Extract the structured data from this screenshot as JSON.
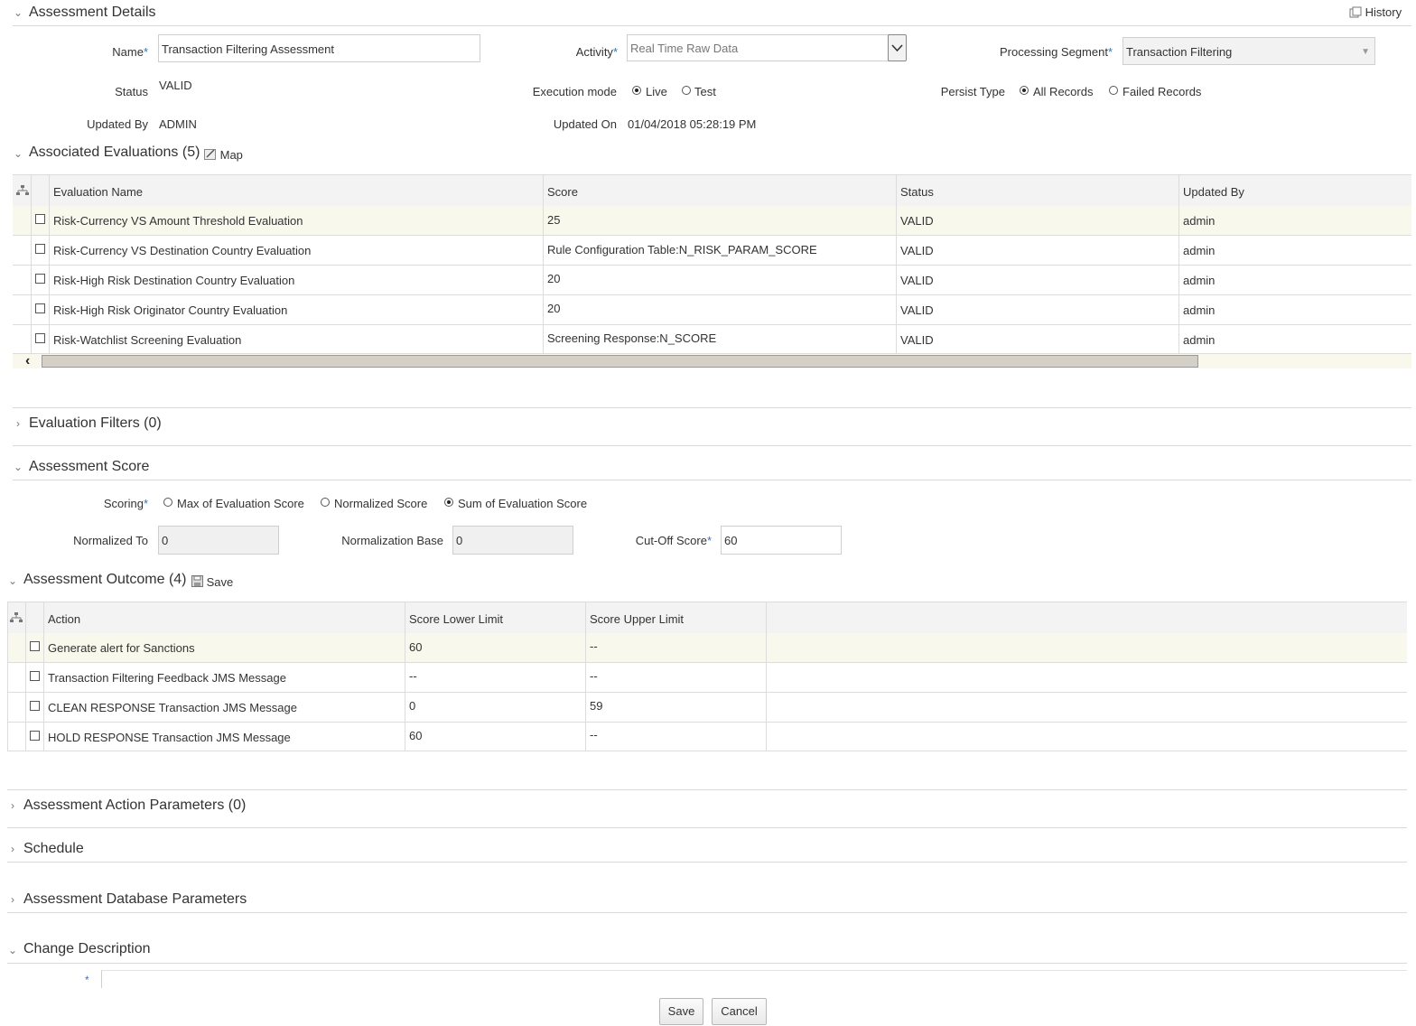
{
  "details": {
    "title": "Assessment Details",
    "history_label": "History",
    "name_label": "Name",
    "name_value": "Transaction Filtering Assessment",
    "activity_label": "Activity",
    "activity_value": "Real Time Raw Data",
    "processing_segment_label": "Processing Segment",
    "processing_segment_value": "Transaction Filtering",
    "status_label": "Status",
    "status_value": "VALID",
    "execution_mode_label": "Execution mode",
    "execution_options": [
      "Live",
      "Test"
    ],
    "execution_selected": "Live",
    "persist_type_label": "Persist Type",
    "persist_options": [
      "All Records",
      "Failed Records"
    ],
    "persist_selected": "All Records",
    "updated_by_label": "Updated By",
    "updated_by_value": "ADMIN",
    "updated_on_label": "Updated On",
    "updated_on_value": "01/04/2018 05:28:19 PM",
    "required_mark": "*"
  },
  "evaluations": {
    "title": "Associated Evaluations",
    "count": "(5)",
    "map_label": "Map",
    "columns": [
      "Evaluation Name",
      "Score",
      "Status",
      "Updated By"
    ],
    "rows": [
      {
        "name": "Risk-Currency VS Amount Threshold Evaluation",
        "score": "25",
        "status": "VALID",
        "updated_by": "admin"
      },
      {
        "name": "Risk-Currency VS Destination Country Evaluation",
        "score": "Rule Configuration Table:N_RISK_PARAM_SCORE",
        "status": "VALID",
        "updated_by": "admin"
      },
      {
        "name": "Risk-High Risk Destination Country Evaluation",
        "score": "20",
        "status": "VALID",
        "updated_by": "admin"
      },
      {
        "name": "Risk-High Risk Originator Country Evaluation",
        "score": "20",
        "status": "VALID",
        "updated_by": "admin"
      },
      {
        "name": "Risk-Watchlist Screening Evaluation",
        "score": "Screening Response:N_SCORE",
        "status": "VALID",
        "updated_by": "admin"
      }
    ]
  },
  "filters": {
    "title": "Evaluation Filters",
    "count": "(0)"
  },
  "score": {
    "title": "Assessment Score",
    "scoring_label": "Scoring",
    "scoring_options": [
      "Max of Evaluation Score",
      "Normalized Score",
      "Sum of Evaluation Score"
    ],
    "scoring_selected": "Sum of Evaluation Score",
    "normalized_to_label": "Normalized To",
    "normalized_to_value": "0",
    "normalization_base_label": "Normalization Base",
    "normalization_base_value": "0",
    "cutoff_label": "Cut-Off Score",
    "cutoff_value": "60"
  },
  "outcome": {
    "title": "Assessment Outcome",
    "count": "(4)",
    "save_label": "Save",
    "columns": [
      "Action",
      "Score Lower Limit",
      "Score Upper Limit"
    ],
    "rows": [
      {
        "action": "Generate alert for Sanctions",
        "lower": "60",
        "upper": "--"
      },
      {
        "action": "Transaction Filtering Feedback JMS Message",
        "lower": "--",
        "upper": "--"
      },
      {
        "action": "CLEAN RESPONSE Transaction JMS Message",
        "lower": "0",
        "upper": "59"
      },
      {
        "action": "HOLD RESPONSE Transaction JMS Message",
        "lower": "60",
        "upper": "--"
      }
    ]
  },
  "action_params": {
    "title": "Assessment Action Parameters",
    "count": "(0)"
  },
  "schedule": {
    "title": "Schedule"
  },
  "db_params": {
    "title": "Assessment Database Parameters"
  },
  "change_description": {
    "title": "Change Description",
    "value": ""
  },
  "footer": {
    "save_label": "Save",
    "cancel_label": "Cancel"
  },
  "colors": {
    "required": "#3a73b4",
    "selected_row": "#f8f8ec",
    "header_bg": "#f3f3f3"
  },
  "icons": [
    "chevron-down-icon",
    "chevron-right-icon",
    "history-icon",
    "map-icon",
    "save-icon",
    "hierarchy-icon",
    "scroll-left-icon",
    "dropdown-arrow-icon"
  ]
}
